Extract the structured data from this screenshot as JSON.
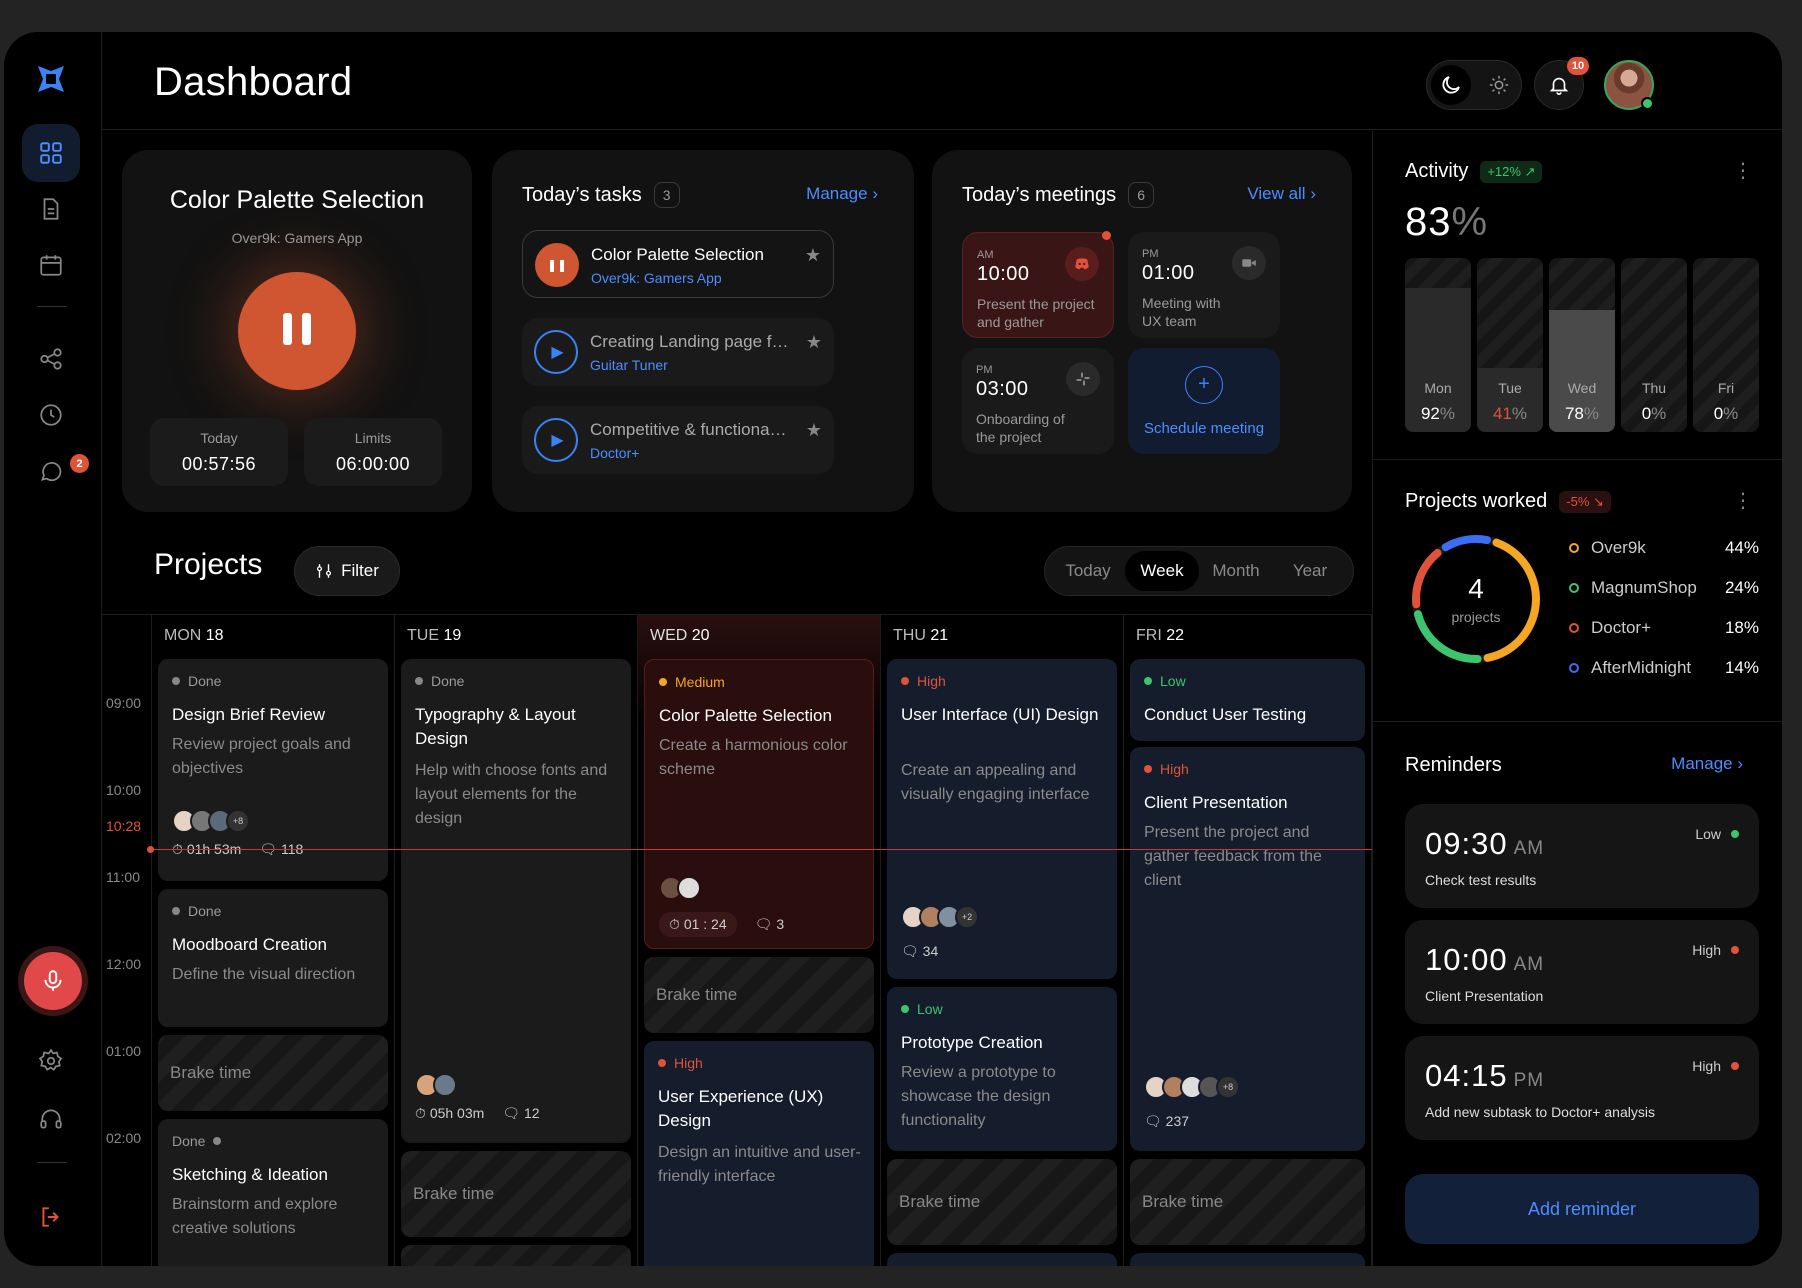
{
  "page_title": "Dashboard",
  "notifications": {
    "count": "10"
  },
  "sidebar": {
    "chat_badge": "2"
  },
  "timer": {
    "title": "Color Palette Selection",
    "subtitle": "Over9k: Gamers App",
    "today_label": "Today",
    "today_value": "00:57:56",
    "limits_label": "Limits",
    "limits_value": "06:00:00"
  },
  "tasks": {
    "title": "Today’s tasks",
    "count": "3",
    "manage": "Manage",
    "items": [
      {
        "title": "Color Palette Selection",
        "project": "Over9k: Gamers App"
      },
      {
        "title": "Creating Landing page for...",
        "project": "Guitar Tuner"
      },
      {
        "title": "Competitive & functional a...",
        "project": "Doctor+"
      }
    ]
  },
  "meetings": {
    "title": "Today’s meetings",
    "count": "6",
    "view_all": "View all",
    "items": [
      {
        "ampm": "AM",
        "time": "10:00",
        "desc": "Present the project and gather feedbac..."
      },
      {
        "ampm": "PM",
        "time": "01:00",
        "desc": "Meeting with UX team"
      },
      {
        "ampm": "PM",
        "time": "03:00",
        "desc": "Onboarding of the project"
      }
    ],
    "schedule": "Schedule meeting"
  },
  "projects": {
    "title": "Projects",
    "filter": "Filter",
    "ranges": [
      "Today",
      "Week",
      "Month",
      "Year"
    ],
    "times": [
      "09:00",
      "10:00",
      "10:28",
      "11:00",
      "12:00",
      "01:00",
      "02:00"
    ],
    "days": [
      {
        "name": "MON",
        "num": "18"
      },
      {
        "name": "TUE",
        "num": "19"
      },
      {
        "name": "WED",
        "num": "20"
      },
      {
        "name": "THU",
        "num": "21"
      },
      {
        "name": "FRI",
        "num": "22"
      }
    ],
    "brake": "Brake time",
    "events": {
      "mon1": {
        "tag": "Done",
        "title": "Design Brief Review",
        "desc": "Review project goals and objectives",
        "more": "+8",
        "time": "01h 53m",
        "comments": "118"
      },
      "mon2": {
        "tag": "Done",
        "title": "Moodboard Creation",
        "desc": "Define the visual direction"
      },
      "mon3": {
        "tag": "Done",
        "title": "Sketching & Ideation",
        "desc": "Brainstorm and explore creative solutions"
      },
      "tue1": {
        "tag": "Done",
        "title": "Typography & Layout Design",
        "desc": "Help with choose fonts and layout elements for the design",
        "time": "05h 03m",
        "comments": "12"
      },
      "wed1": {
        "tag": "Medium",
        "title": "Color Palette Selection",
        "desc": "Create a harmonious color scheme",
        "time": "01 : 24",
        "comments": "3"
      },
      "wed2": {
        "tag": "High",
        "title": "User Experience (UX) Design",
        "desc": "Design an intuitive and user-friendly interface"
      },
      "thu1": {
        "tag": "High",
        "title": "User Interface (UI) Design",
        "desc": "Create an appealing and visually engaging interface",
        "more": "+2",
        "comments": "34"
      },
      "thu2": {
        "tag": "Low",
        "title": "Prototype Creation",
        "desc": "Review a prototype to showcase the design functionality"
      },
      "fri1": {
        "tag": "Low",
        "title": "Conduct User Testing"
      },
      "fri2": {
        "tag": "High",
        "title": "Client Presentation",
        "desc": "Present the project and gather feedback from the client",
        "more": "+8",
        "comments": "237"
      }
    }
  },
  "activity": {
    "title": "Activity",
    "trend": "+12%",
    "value": "83",
    "unit": "%",
    "bars": [
      {
        "day": "Mon",
        "pct": "92",
        "value": 0.92
      },
      {
        "day": "Tue",
        "pct": "41",
        "value": 0.41
      },
      {
        "day": "Wed",
        "pct": "78",
        "value": 0.78
      },
      {
        "day": "Thu",
        "pct": "0",
        "value": 0
      },
      {
        "day": "Fri",
        "pct": "0",
        "value": 0
      }
    ],
    "pct_sign": "%"
  },
  "projects_worked": {
    "title": "Projects worked",
    "trend": "-5%",
    "count": "4",
    "count_label": "projects",
    "items": [
      {
        "name": "Over9k",
        "pct": "44%",
        "color": "#f5a623"
      },
      {
        "name": "MagnumShop",
        "pct": "24%",
        "color": "#3ec46d"
      },
      {
        "name": "Doctor+",
        "pct": "18%",
        "color": "#e0533a"
      },
      {
        "name": "AfterMidnight",
        "pct": "14%",
        "color": "#3b6ef5"
      }
    ]
  },
  "reminders": {
    "title": "Reminders",
    "manage": "Manage",
    "items": [
      {
        "time": "09:30",
        "ampm": "AM",
        "desc": "Check test results",
        "priority": "Low"
      },
      {
        "time": "10:00",
        "ampm": "AM",
        "desc": "Client Presentation",
        "priority": "High"
      },
      {
        "time": "04:15",
        "ampm": "PM",
        "desc": "Add new subtask  to Doctor+ analysis",
        "priority": "High"
      }
    ],
    "add": "Add reminder"
  }
}
